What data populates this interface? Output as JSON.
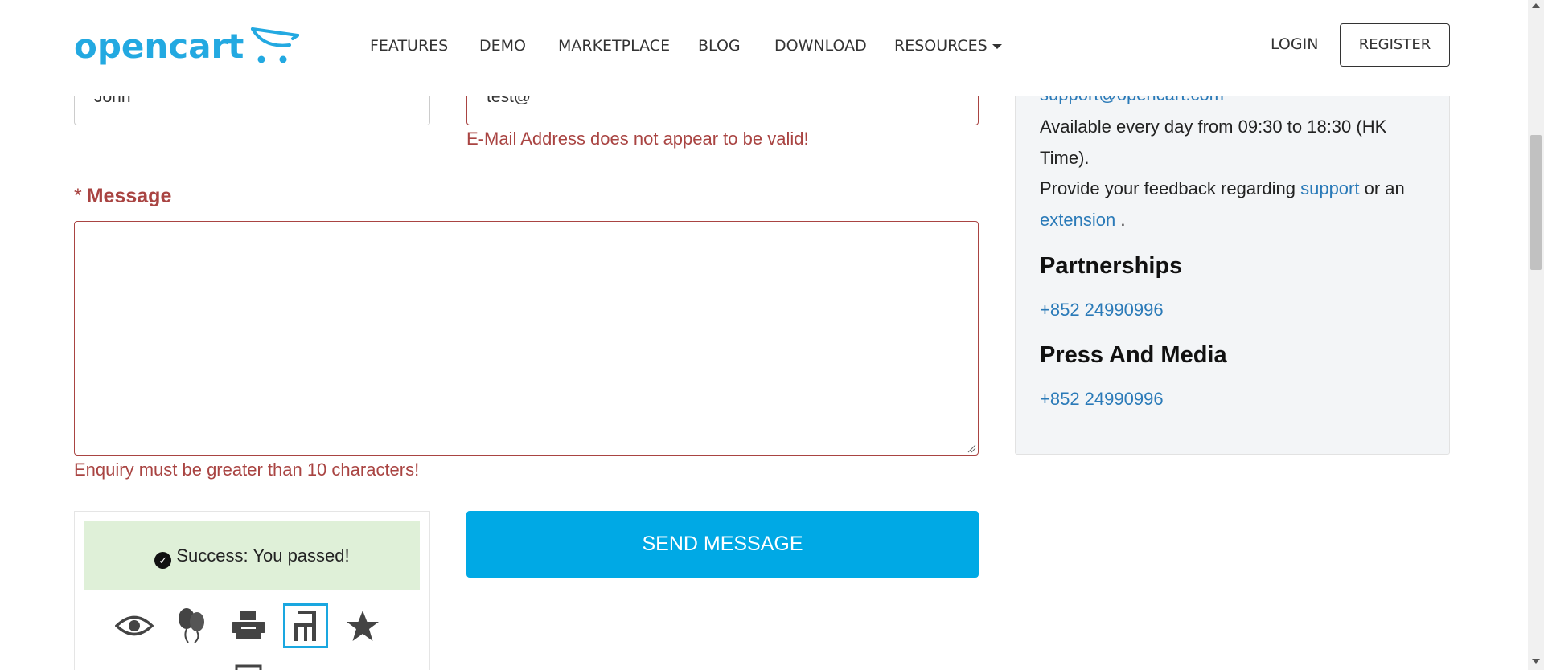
{
  "brand": {
    "logo_text": "opencart",
    "colors": {
      "brand": "#23a9e1",
      "error": "#a94442",
      "accent": "#00a9e5",
      "link": "#2a7ab8",
      "success_bg": "#dff0d8"
    }
  },
  "nav": {
    "items": [
      "FEATURES",
      "DEMO",
      "MARKETPLACE",
      "BLOG",
      "DOWNLOAD",
      "RESOURCES"
    ],
    "login": "LOGIN",
    "register": "REGISTER"
  },
  "form": {
    "name_value": "John",
    "email_value": "test@",
    "email_error": "E-Mail Address does not appear to be valid!",
    "message_label": "Message",
    "message_required_mark": "*",
    "message_value": "",
    "message_error": "Enquiry must be greater than 10 characters!",
    "send_label": "SEND MESSAGE"
  },
  "captcha": {
    "success_text": "Success: You passed!",
    "icons": [
      "eye-icon",
      "balloons-icon",
      "printer-icon",
      "chair-icon",
      "star-icon",
      "square-icon"
    ],
    "selected": "chair-icon"
  },
  "sidebar": {
    "email_link": "support@opencart.com",
    "hours_line1": "Available every day from 09:30 to 18:30 (HK",
    "hours_line2": "Time).",
    "feedback_prefix": "Provide your feedback regarding",
    "feedback_link_support": "support",
    "feedback_middle": "or an",
    "feedback_link_extension": "extension",
    "feedback_suffix": ".",
    "partnerships_heading": "Partnerships",
    "partnerships_phone": "+852 24990996",
    "press_heading": "Press And Media",
    "press_phone": "+852 24990996"
  }
}
